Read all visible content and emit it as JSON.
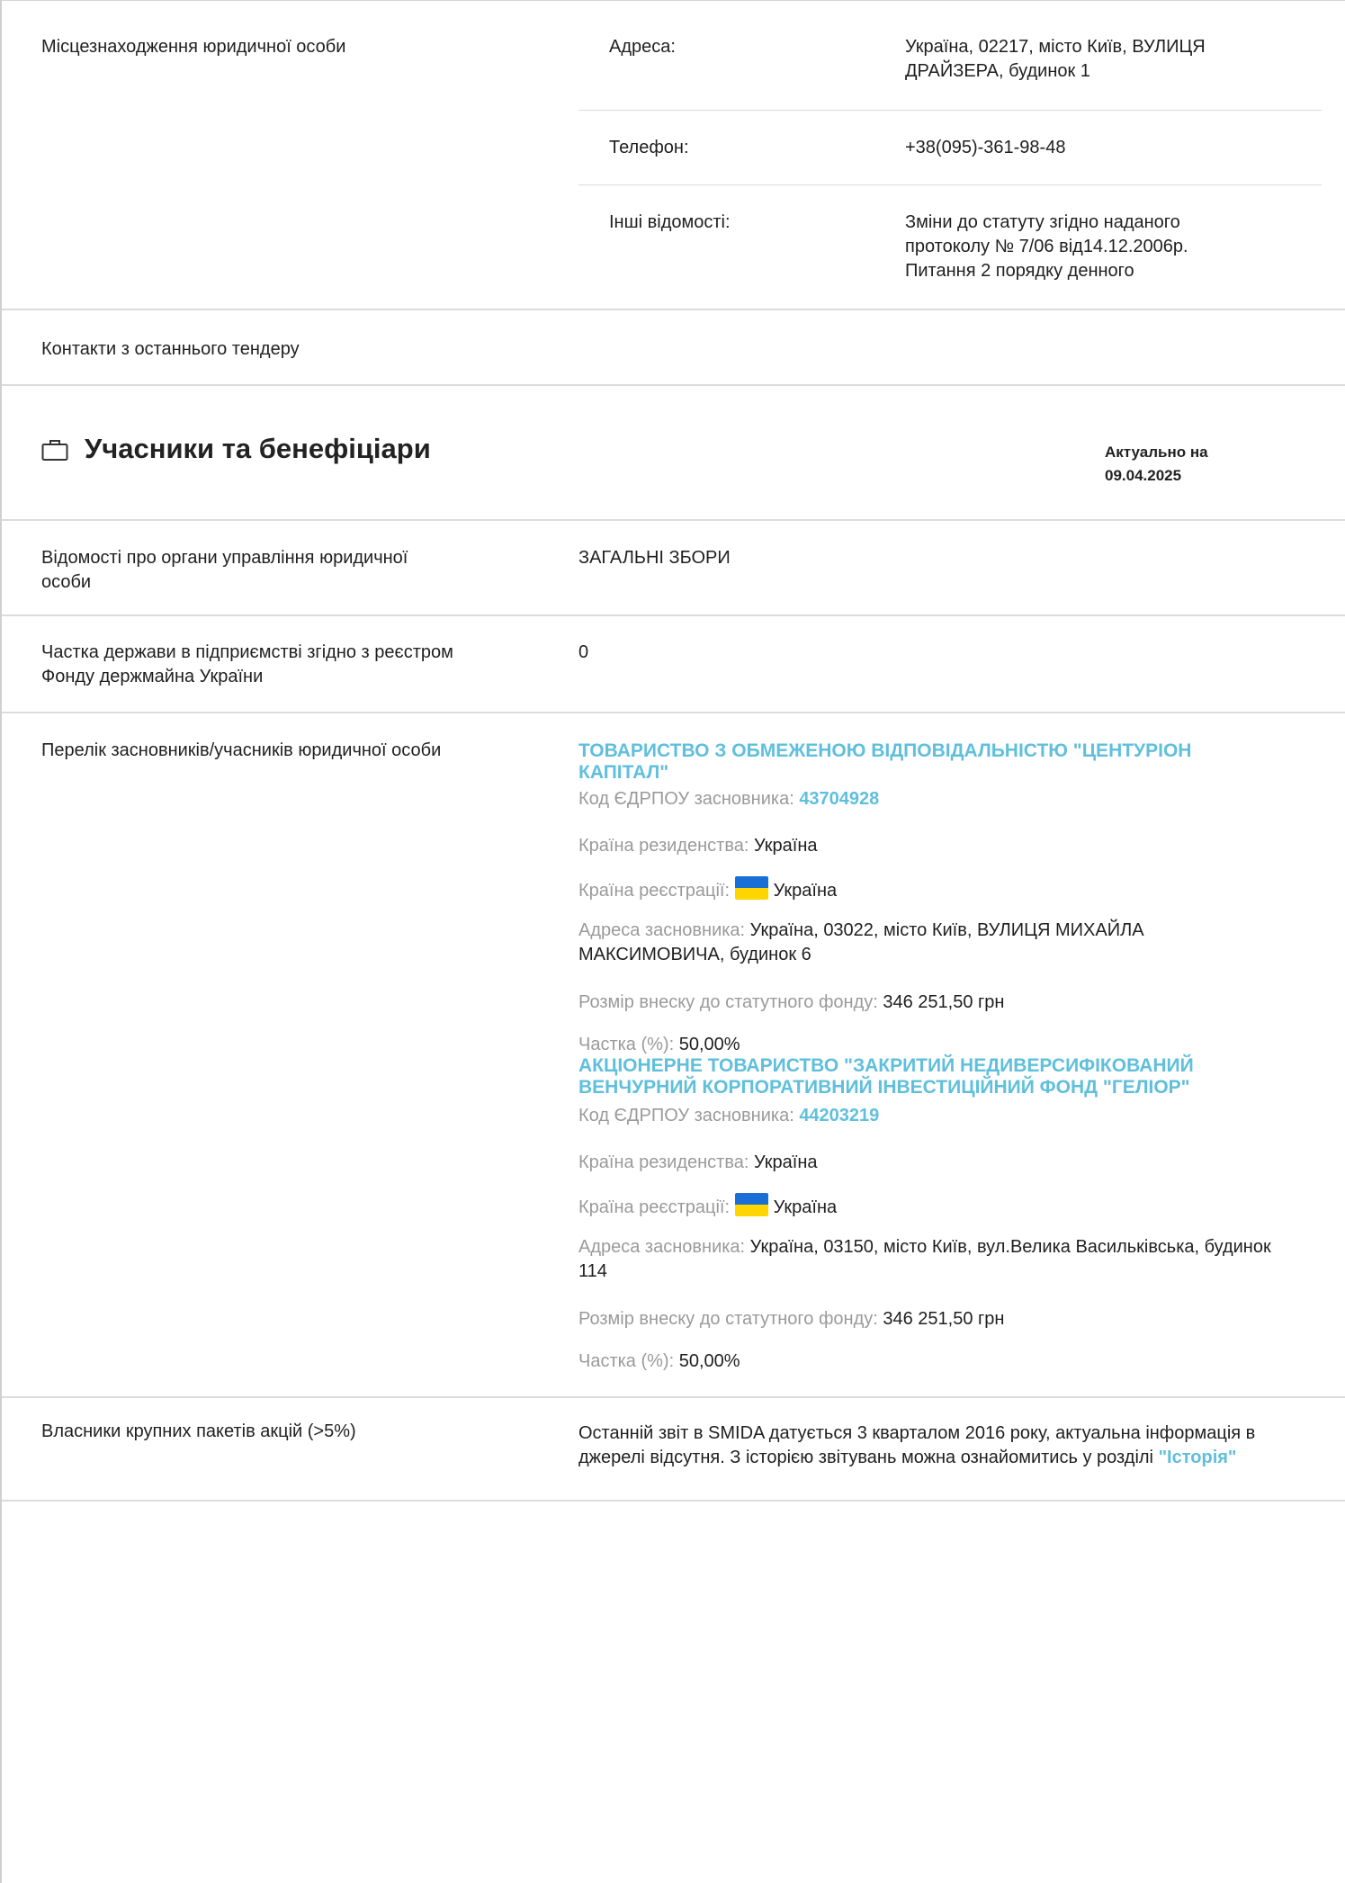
{
  "location": {
    "label": "Місцезнаходження юридичної особи",
    "address_key": "Адреса:",
    "address_value_line1": "Україна, 02217, місто Київ, ВУЛИЦЯ",
    "address_value_line2": "ДРАЙЗЕРА, будинок 1",
    "phone_key": "Телефон:",
    "phone_value": "+38(095)-361-98-48",
    "other_key": "Інші відомості:",
    "other_value_line1": "Зміни до статуту згідно наданого",
    "other_value_line2": "протоколу № 7/06 від14.12.2006р.",
    "other_value_line3": "Питання 2 порядку денного"
  },
  "contacts": {
    "label": "Контакти з останнього тендеру"
  },
  "section": {
    "icon": "briefcase-icon",
    "title": "Учасники та бенефіціари",
    "actual_label": "Актуально на",
    "actual_date": "09.04.2025"
  },
  "governance": {
    "label_line1": "Відомості про органи управління юридичної",
    "label_line2": "особи",
    "value": "ЗАГАЛЬНІ ЗБОРИ"
  },
  "state_share": {
    "label_line1": "Частка держави в підприємстві згідно з реєстром",
    "label_line2": "Фонду держмайна України",
    "value": "0"
  },
  "founders": {
    "label": "Перелік засновників/учасників юридичної особи",
    "items": [
      {
        "name_line1": "ТОВАРИСТВО З ОБМЕЖЕНОЮ ВІДПОВІДАЛЬНІСТЮ \"ЦЕНТУРІОН",
        "name_line2": "КАПІТАЛ\"",
        "code_label": "Код ЄДРПОУ засновника:",
        "code": "43704928",
        "residence_label": "Країна резиденства:",
        "residence": "Україна",
        "registration_label": "Країна реєстрації:",
        "registration": "Україна",
        "address_label": "Адреса засновника:",
        "address_line1": "Україна, 03022, місто Київ, ВУЛИЦЯ МИХАЙЛА",
        "address_line2": "МАКСИМОВИЧА, будинок 6",
        "contribution_label": "Розмір внеску до статутного фонду:",
        "contribution": "346 251,50 грн",
        "share_label": "Частка (%):",
        "share": "50,00%"
      },
      {
        "name_line1": "АКЦІОНЕРНЕ ТОВАРИСТВО \"ЗАКРИТИЙ НЕДИВЕРСИФІКОВАНИЙ",
        "name_line2": "ВЕНЧУРНИЙ КОРПОРАТИВНИЙ ІНВЕСТИЦІЙНИЙ ФОНД \"ГЕЛІОР\"",
        "code_label": "Код ЄДРПОУ засновника:",
        "code": "44203219",
        "residence_label": "Країна резиденства:",
        "residence": "Україна",
        "registration_label": "Країна реєстрації:",
        "registration": "Україна",
        "address_label": "Адреса засновника:",
        "address_line1": "Україна, 03150, місто Київ, вул.Велика Васильківська, будинок",
        "address_line2": "114",
        "contribution_label": "Розмір внеску до статутного фонду:",
        "contribution": "346 251,50 грн",
        "share_label": "Частка (%):",
        "share": "50,00%"
      }
    ]
  },
  "shareholders": {
    "label": "Власники крупних пакетів акцій (>5%)",
    "text_line1": "Останній звіт в SMIDA датується 3 кварталом 2016 року, актуальна інформація в",
    "text_line2": "джерелі відсутня. З історією звітувань можна ознайомитись у розділі",
    "history_link": "\"Історія\""
  },
  "colors": {
    "accent": "#5fbfdd",
    "muted": "#9a9a9a",
    "border": "#dcdcdc",
    "flag_blue": "#1a6fd6",
    "flag_yellow": "#ffd500"
  }
}
